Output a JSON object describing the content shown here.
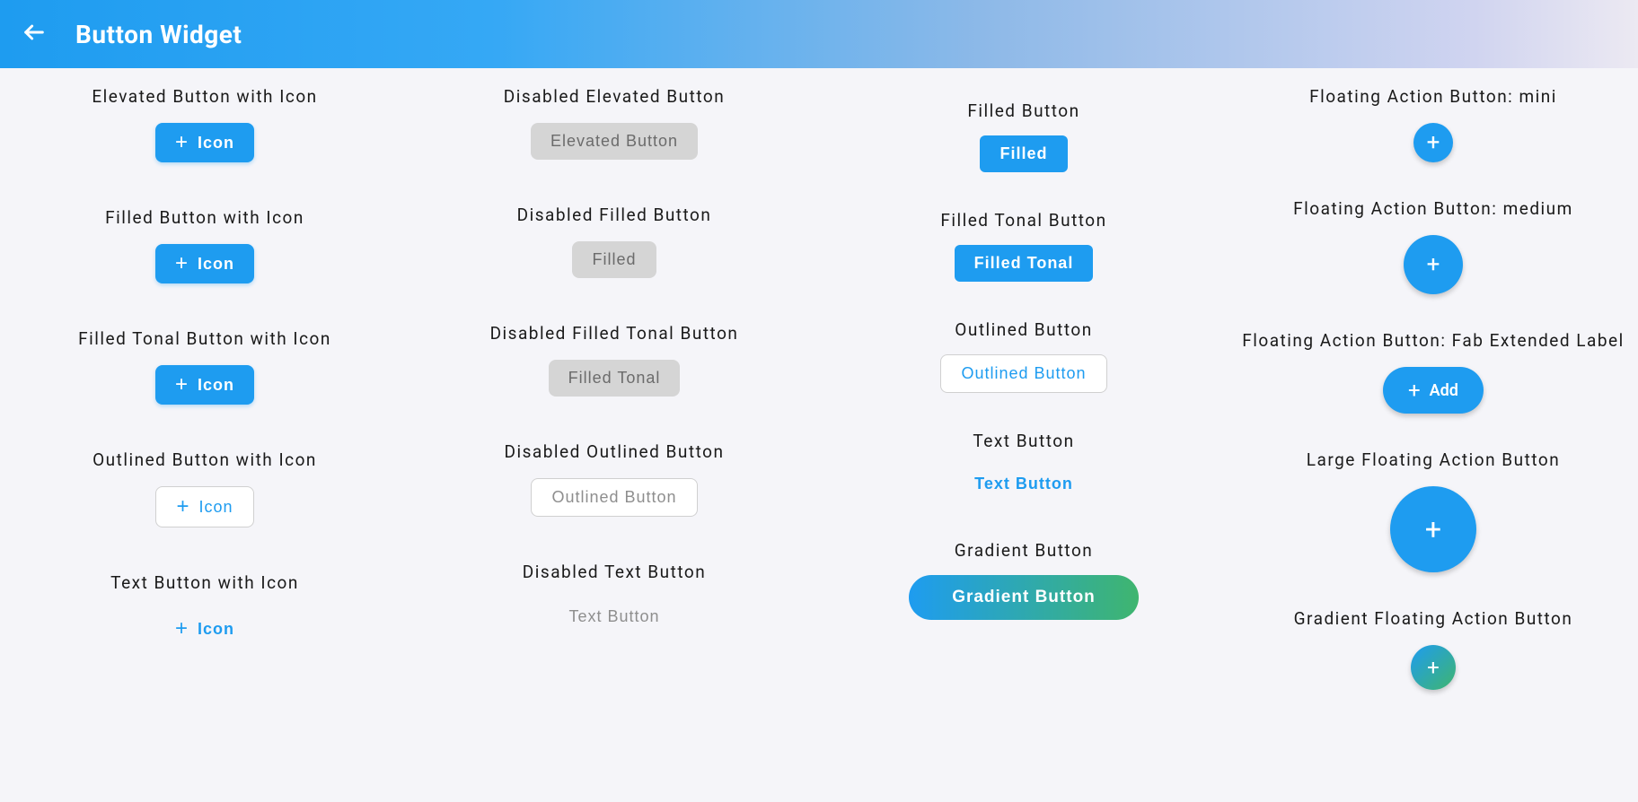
{
  "appbar": {
    "title": "Button Widget"
  },
  "col1": {
    "s1": {
      "label": "Elevated Button with Icon",
      "btn": "Icon"
    },
    "s2": {
      "label": "Filled Button  with Icon",
      "btn": "Icon"
    },
    "s3": {
      "label": "Filled Tonal Button with Icon",
      "btn": "Icon"
    },
    "s4": {
      "label": "Outlined Button with Icon",
      "btn": "Icon"
    },
    "s5": {
      "label": "Text Button with Icon",
      "btn": "Icon"
    }
  },
  "col2": {
    "s1": {
      "label": "Disabled  Elevated Button",
      "btn": "Elevated Button"
    },
    "s2": {
      "label": "Disabled Filled Button",
      "btn": "Filled"
    },
    "s3": {
      "label": "Disabled Filled Tonal Button",
      "btn": "Filled Tonal"
    },
    "s4": {
      "label": "Disabled Outlined Button",
      "btn": "Outlined Button"
    },
    "s5": {
      "label": "Disabled Text Button",
      "btn": "Text Button"
    }
  },
  "col3": {
    "s1": {
      "label": "Filled Button",
      "btn": "Filled"
    },
    "s2": {
      "label": "Filled Tonal Button",
      "btn": "Filled Tonal"
    },
    "s3": {
      "label": "Outlined Button",
      "btn": "Outlined Button"
    },
    "s4": {
      "label": "Text Button",
      "btn": "Text Button"
    },
    "s5": {
      "label": "Gradient Button",
      "btn": "Gradient Button"
    }
  },
  "col4": {
    "s1": {
      "label": "Floating Action Button: mini"
    },
    "s2": {
      "label": "Floating Action Button: medium"
    },
    "s3": {
      "label": "Floating Action Button: Fab Extended Label",
      "btn": "Add"
    },
    "s4": {
      "label": "Large Floating Action Button"
    },
    "s5": {
      "label": "Gradient Floating Action Button"
    }
  }
}
